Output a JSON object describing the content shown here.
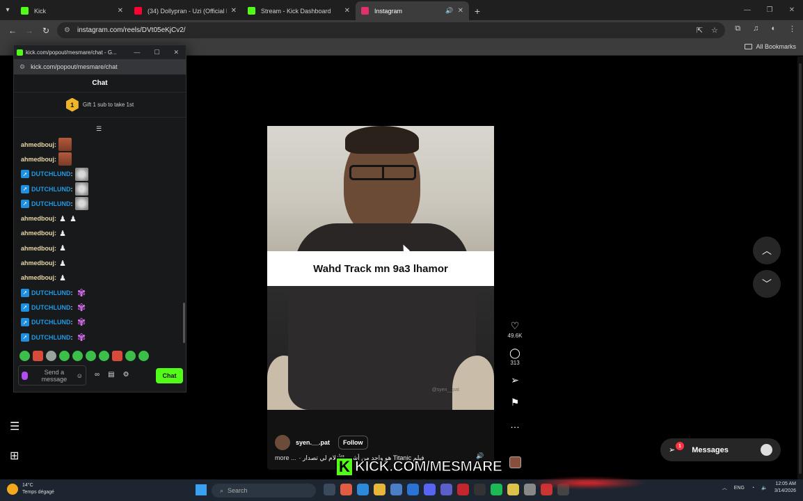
{
  "browser": {
    "tabs": [
      {
        "title": "Kick",
        "favicon_color": "#53fc18",
        "active": false
      },
      {
        "title": "(34) Dollypran - Uzi (Official Mu",
        "favicon_color": "#ff0033",
        "active": false
      },
      {
        "title": "Stream - Kick Dashboard",
        "favicon_color": "#53fc18",
        "active": false
      },
      {
        "title": "Instagram",
        "favicon_color": "#e1306c",
        "active": true
      }
    ],
    "url": "instagram.com/reels/DVt05eKjCv2/",
    "all_bookmarks": "All Bookmarks"
  },
  "popout": {
    "window_title": "kick.com/popout/mesmare/chat - G...",
    "url": "kick.com/popout/mesmare/chat",
    "header": "Chat",
    "gift_rank": "1",
    "gift_text": "Gift 1 sub to take 1st",
    "messages": [
      {
        "user": "ahmedbouj",
        "style": "gold",
        "badge": false,
        "emotes": [
          "face"
        ]
      },
      {
        "user": "ahmedbouj",
        "style": "gold",
        "badge": false,
        "emotes": [
          "face"
        ]
      },
      {
        "user": "DUTCHLUND",
        "style": "blue",
        "badge": true,
        "emotes": [
          "cat"
        ]
      },
      {
        "user": "DUTCHLUND",
        "style": "blue",
        "badge": true,
        "emotes": [
          "cat"
        ]
      },
      {
        "user": "DUTCHLUND",
        "style": "blue",
        "badge": true,
        "emotes": [
          "cat"
        ]
      },
      {
        "user": "ahmedbouj",
        "style": "gold",
        "badge": false,
        "emotes": [
          "small",
          "small"
        ]
      },
      {
        "user": "ahmedbouj",
        "style": "gold",
        "badge": false,
        "emotes": [
          "small"
        ]
      },
      {
        "user": "ahmedbouj",
        "style": "gold",
        "badge": false,
        "emotes": [
          "small"
        ]
      },
      {
        "user": "ahmedbouj",
        "style": "gold",
        "badge": false,
        "emotes": [
          "small"
        ]
      },
      {
        "user": "ahmedbouj",
        "style": "gold",
        "badge": false,
        "emotes": [
          "small"
        ]
      },
      {
        "user": "DUTCHLUND",
        "style": "blue",
        "badge": true,
        "emotes": [
          "pink"
        ]
      },
      {
        "user": "DUTCHLUND",
        "style": "blue",
        "badge": true,
        "emotes": [
          "pink"
        ]
      },
      {
        "user": "DUTCHLUND",
        "style": "blue",
        "badge": true,
        "emotes": [
          "pink"
        ]
      },
      {
        "user": "DUTCHLUND",
        "style": "blue",
        "badge": true,
        "emotes": [
          "pink"
        ]
      }
    ],
    "input_placeholder": "Send a message",
    "send_label": "Chat"
  },
  "reel": {
    "caption_overlay": "Wahd Track mn 9a3 lhamor",
    "video_watermark": "@syen__pat",
    "username": "syen.__.pat",
    "follow_label": "Follow",
    "caption_more": "more ...",
    "caption_text": "فيلم Titanic هو واحد من أشهر الأفلام لي تصدار ·",
    "likes": "49.6K",
    "comments": "313"
  },
  "messages_widget": {
    "label": "Messages",
    "badge": "1"
  },
  "stream_overlay": "KICK.COM/MESMARE",
  "taskbar": {
    "weather_temp": "14°C",
    "weather_desc": "Temps dégagé",
    "search_placeholder": "Search",
    "lang": "ENG",
    "time": "12:05 AM",
    "date": "3/14/2026"
  }
}
